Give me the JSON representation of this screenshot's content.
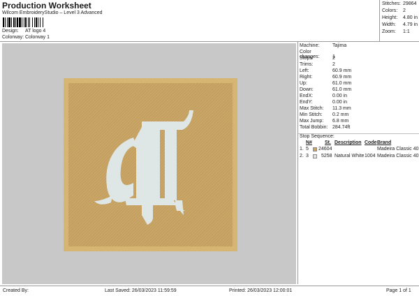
{
  "header": {
    "title": "Production Worksheet",
    "subtitle": "Wilcom EmbroideryStudio – Level 3 Advanced",
    "design_label": "Design:",
    "design_value": "AT logo 4",
    "colorway_label": "Colorway:",
    "colorway_value": "Colorway 1"
  },
  "stats": [
    {
      "label": "Stitches:",
      "value": "29864"
    },
    {
      "label": "Colors:",
      "value": "2"
    },
    {
      "label": "Height:",
      "value": "4.80 in"
    },
    {
      "label": "Width:",
      "value": "4.79 in"
    },
    {
      "label": "Zoom:",
      "value": "1:1"
    }
  ],
  "info": [
    {
      "label": "Machine:",
      "value": "Tajima"
    },
    {
      "label": "Color changes:",
      "value": "1"
    },
    {
      "label": "Stops:",
      "value": "2"
    },
    {
      "label": "Trims:",
      "value": "2"
    },
    {
      "label": "Left:",
      "value": "60.9 mm"
    },
    {
      "label": "Right:",
      "value": "60.9 mm"
    },
    {
      "label": "Up:",
      "value": "61.0 mm"
    },
    {
      "label": "Down:",
      "value": "61.0 mm"
    },
    {
      "label": "EndX:",
      "value": "0.00 in"
    },
    {
      "label": "EndY:",
      "value": "0.00 in"
    },
    {
      "label": "Max Stitch:",
      "value": "11.3 mm"
    },
    {
      "label": "Min Stitch:",
      "value": "0.2 mm"
    },
    {
      "label": "Max Jump:",
      "value": "6.8 mm"
    },
    {
      "label": "Total Bobbin:",
      "value": "284.74ft"
    }
  ],
  "stop_sequence": {
    "title": "Stop Sequence:",
    "columns": {
      "n": "N#",
      "st": "St.",
      "description": "Description",
      "code": "Code",
      "brand": "Brand"
    },
    "rows": [
      {
        "idx": "1.",
        "n": "5",
        "color": "#c9a567",
        "st": "24604",
        "description": "",
        "code": "",
        "brand": "Madeira Classic 40"
      },
      {
        "idx": "2.",
        "n": "3",
        "color": "#dfe6e6",
        "st": "5258",
        "description": "Natural White",
        "code": "1004",
        "brand": "Madeira Classic 40"
      }
    ]
  },
  "footer": {
    "created_by": "Created By:",
    "last_saved": "Last Saved: 26/03/2023 11:59:59",
    "printed": "Printed: 26/03/2023 12:00:01",
    "page": "Page 1 of 1"
  },
  "colors": {
    "background": "#c8c8c8",
    "patch_fill": "#c9a567",
    "patch_border": "#d9b978",
    "letters": "#dfe6e6"
  }
}
